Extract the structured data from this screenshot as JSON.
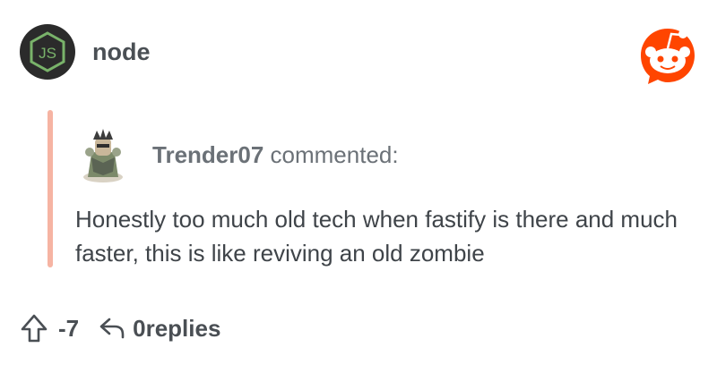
{
  "subreddit": {
    "icon": "nodejs-logo-icon",
    "icon_text": "JS",
    "name": "node"
  },
  "brand": {
    "logo": "reddit-logo-icon",
    "accent_color": "#ff4500"
  },
  "comment": {
    "author": "Trender07",
    "action_text": "commented:",
    "avatar": "user-avatar",
    "body": "Honestly too much old tech when fastify is there and much faster, this is like reviving an old zombie",
    "quote_bar_color": "#f6b4a3"
  },
  "actions": {
    "upvote_icon": "upvote-arrow-icon",
    "score": "-7",
    "reply_icon": "reply-icon",
    "replies_label": "0replies"
  }
}
